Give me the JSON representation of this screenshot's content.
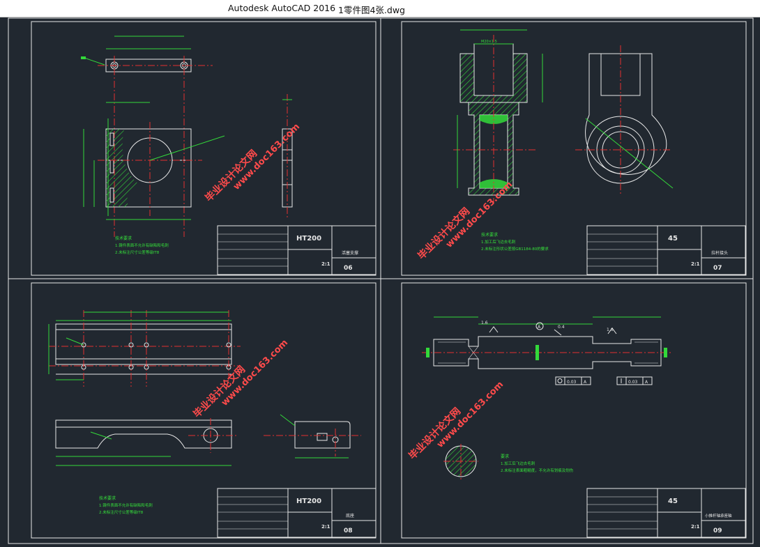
{
  "window": {
    "app_title": "Autodesk AutoCAD 2016",
    "file_name": "1零件图4张.dwg"
  },
  "watermark": {
    "cn": "毕业设计论文网",
    "url": "www.doc163.com"
  },
  "sheets": [
    {
      "material": "HT200",
      "part_name": "活塞支撑",
      "scale": "2:1",
      "number": "06",
      "notes_title": "技术要求",
      "notes": [
        "1.铸件表面不允许有缺陷和毛刺",
        "2.未标注尺寸公差等级IT8"
      ]
    },
    {
      "material": "45",
      "part_name": "拉杆接头",
      "scale": "2:1",
      "number": "07",
      "notes_title": "技术要求",
      "notes": [
        "1.加工后飞边去毛刺",
        "2.未标注形状公差按GB1184-80的要求"
      ],
      "dim_thread": "M20×1.5"
    },
    {
      "material": "HT200",
      "part_name": "底座",
      "scale": "2:1",
      "number": "08",
      "notes_title": "技术要求",
      "notes": [
        "1.铸件表面不允许有缺陷和毛刺",
        "2.未标注尺寸公差等级IT8"
      ]
    },
    {
      "material": "45",
      "part_name": "小推杆轴承座轴",
      "scale": "2:1",
      "number": "09",
      "notes_title": "要求",
      "notes": [
        "1.加工后飞边去毛刺",
        "2.未标注表面粗糙度，不允许有划痕及划伤"
      ],
      "roughness_1": "1.6",
      "roughness_2": "1.6",
      "roughness_3": "0.4",
      "datum": "A",
      "tol_1": "0.03",
      "tol_2": "0.03",
      "tol_datum": "A"
    }
  ]
}
